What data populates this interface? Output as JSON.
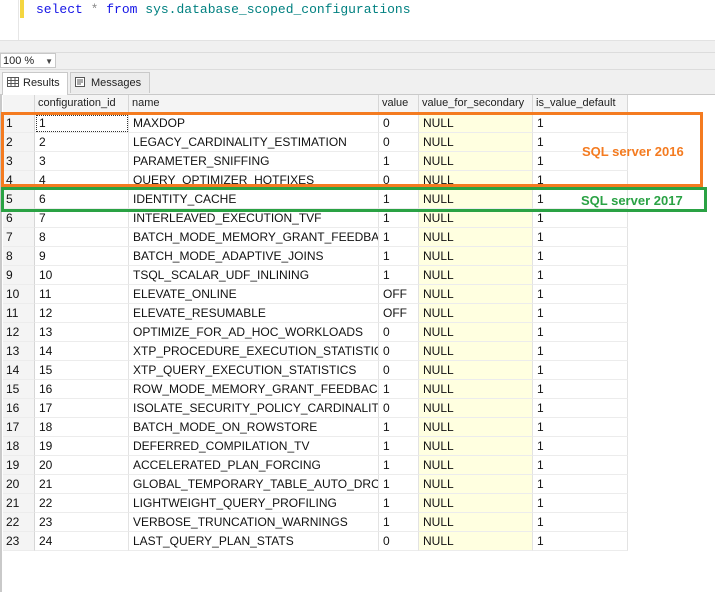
{
  "editor": {
    "keyword_select": "select",
    "star": "*",
    "keyword_from": "from",
    "table": "sys.database_scoped_configurations"
  },
  "zoom": {
    "value": "100 %"
  },
  "tabs": [
    {
      "label": "Results",
      "icon": "grid-icon",
      "active": true
    },
    {
      "label": "Messages",
      "icon": "messages-icon",
      "active": false
    }
  ],
  "grid": {
    "columns": [
      "configuration_id",
      "name",
      "value",
      "value_for_secondary",
      "is_value_default"
    ],
    "rows": [
      [
        "1",
        "1",
        "MAXDOP",
        "0",
        "NULL",
        "1"
      ],
      [
        "2",
        "2",
        "LEGACY_CARDINALITY_ESTIMATION",
        "0",
        "NULL",
        "1"
      ],
      [
        "3",
        "3",
        "PARAMETER_SNIFFING",
        "1",
        "NULL",
        "1"
      ],
      [
        "4",
        "4",
        "QUERY_OPTIMIZER_HOTFIXES",
        "0",
        "NULL",
        "1"
      ],
      [
        "5",
        "6",
        "IDENTITY_CACHE",
        "1",
        "NULL",
        "1"
      ],
      [
        "6",
        "7",
        "INTERLEAVED_EXECUTION_TVF",
        "1",
        "NULL",
        "1"
      ],
      [
        "7",
        "8",
        "BATCH_MODE_MEMORY_GRANT_FEEDBACK",
        "1",
        "NULL",
        "1"
      ],
      [
        "8",
        "9",
        "BATCH_MODE_ADAPTIVE_JOINS",
        "1",
        "NULL",
        "1"
      ],
      [
        "9",
        "10",
        "TSQL_SCALAR_UDF_INLINING",
        "1",
        "NULL",
        "1"
      ],
      [
        "10",
        "11",
        "ELEVATE_ONLINE",
        "OFF",
        "NULL",
        "1"
      ],
      [
        "11",
        "12",
        "ELEVATE_RESUMABLE",
        "OFF",
        "NULL",
        "1"
      ],
      [
        "12",
        "13",
        "OPTIMIZE_FOR_AD_HOC_WORKLOADS",
        "0",
        "NULL",
        "1"
      ],
      [
        "13",
        "14",
        "XTP_PROCEDURE_EXECUTION_STATISTICS",
        "0",
        "NULL",
        "1"
      ],
      [
        "14",
        "15",
        "XTP_QUERY_EXECUTION_STATISTICS",
        "0",
        "NULL",
        "1"
      ],
      [
        "15",
        "16",
        "ROW_MODE_MEMORY_GRANT_FEEDBACK",
        "1",
        "NULL",
        "1"
      ],
      [
        "16",
        "17",
        "ISOLATE_SECURITY_POLICY_CARDINALITY",
        "0",
        "NULL",
        "1"
      ],
      [
        "17",
        "18",
        "BATCH_MODE_ON_ROWSTORE",
        "1",
        "NULL",
        "1"
      ],
      [
        "18",
        "19",
        "DEFERRED_COMPILATION_TV",
        "1",
        "NULL",
        "1"
      ],
      [
        "19",
        "20",
        "ACCELERATED_PLAN_FORCING",
        "1",
        "NULL",
        "1"
      ],
      [
        "20",
        "21",
        "GLOBAL_TEMPORARY_TABLE_AUTO_DROP",
        "1",
        "NULL",
        "1"
      ],
      [
        "21",
        "22",
        "LIGHTWEIGHT_QUERY_PROFILING",
        "1",
        "NULL",
        "1"
      ],
      [
        "22",
        "23",
        "VERBOSE_TRUNCATION_WARNINGS",
        "1",
        "NULL",
        "1"
      ],
      [
        "23",
        "24",
        "LAST_QUERY_PLAN_STATS",
        "0",
        "NULL",
        "1"
      ]
    ]
  },
  "annotations": {
    "sql2016": {
      "label": "SQL server 2016",
      "color": "#f47b20"
    },
    "sql2017": {
      "label": "SQL server 2017",
      "color": "#2aa244"
    }
  }
}
